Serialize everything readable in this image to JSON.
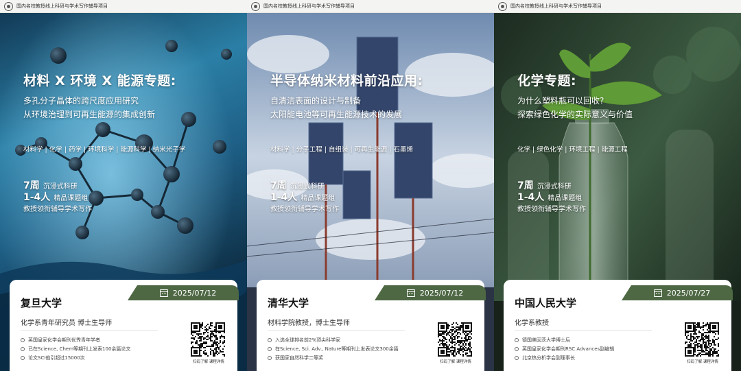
{
  "header_text": "国内名校教授线上科研与学术写作辅导项目",
  "posters": [
    {
      "headline": "材料 X 环境 X 能源专题:",
      "subline1": "多孔分子晶体的跨尺度应用研究",
      "subline2": "从环境治理到可再生能源的集成创新",
      "tags": "材料学 | 化学 | 药学 | 环境科学 | 能源科学 | 纳米光子学",
      "weeks": "7周",
      "weeks_desc": "沉浸式科研",
      "group": "1-4人",
      "group_desc": "精品课题组",
      "guide": "教授领衔辅导学术写作",
      "date": "2025/07/12",
      "school": "复旦大学",
      "role": "化学系青年研究员  博士生导师",
      "bullets": [
        "英国皇家化学会期刊优秀青年学者",
        "已在Science, Chem等期刊上发表100余篇论文",
        "论文SCI他引超过15000次"
      ],
      "qr_caption": "扫码了解  课程详情",
      "theme": "#2f7fa8"
    },
    {
      "headline": "半导体纳米材料前沿应用:",
      "subline1": "自清洁表面的设计与制备",
      "subline2": "太阳能电池等可再生能源技术的发展",
      "tags": "材料学 | 分子工程 | 自组装 | 可再生能源 | 石墨烯",
      "weeks": "7周",
      "weeks_desc": "沉浸式科研",
      "group": "1-4人",
      "group_desc": "精品课题组",
      "guide": "教授领衔辅导学术写作",
      "date": "2025/07/12",
      "school": "清华大学",
      "role": "材料学院教授，博士生导师",
      "bullets": [
        "入选全球排名前2%顶尖科学家",
        "在Science, Sci. Adv., Nature等期刊上发表论文300余篇",
        "获国家自然科学二等奖"
      ],
      "qr_caption": "扫码了解  课程详情",
      "theme": "#6d7f9a"
    },
    {
      "headline": "化学专题:",
      "subline1": "为什么塑料瓶可以回收?",
      "subline2": "探索绿色化学的实际意义与价值",
      "tags": "化学 | 绿色化学 | 环境工程 | 能源工程",
      "weeks": "7周",
      "weeks_desc": "沉浸式科研",
      "group": "1-4人",
      "group_desc": "精品课题组",
      "guide": "教授领衔辅导学术写作",
      "date": "2025/07/27",
      "school": "中国人民大学",
      "role": "化学系教授",
      "bullets": [
        "德国美因茨大学博士后",
        "英国皇家化学会期刊RSC Advances副编辑",
        "北京热分析学会副理事长"
      ],
      "qr_caption": "扫码了解  课程详情",
      "theme": "#2e4a34"
    }
  ]
}
